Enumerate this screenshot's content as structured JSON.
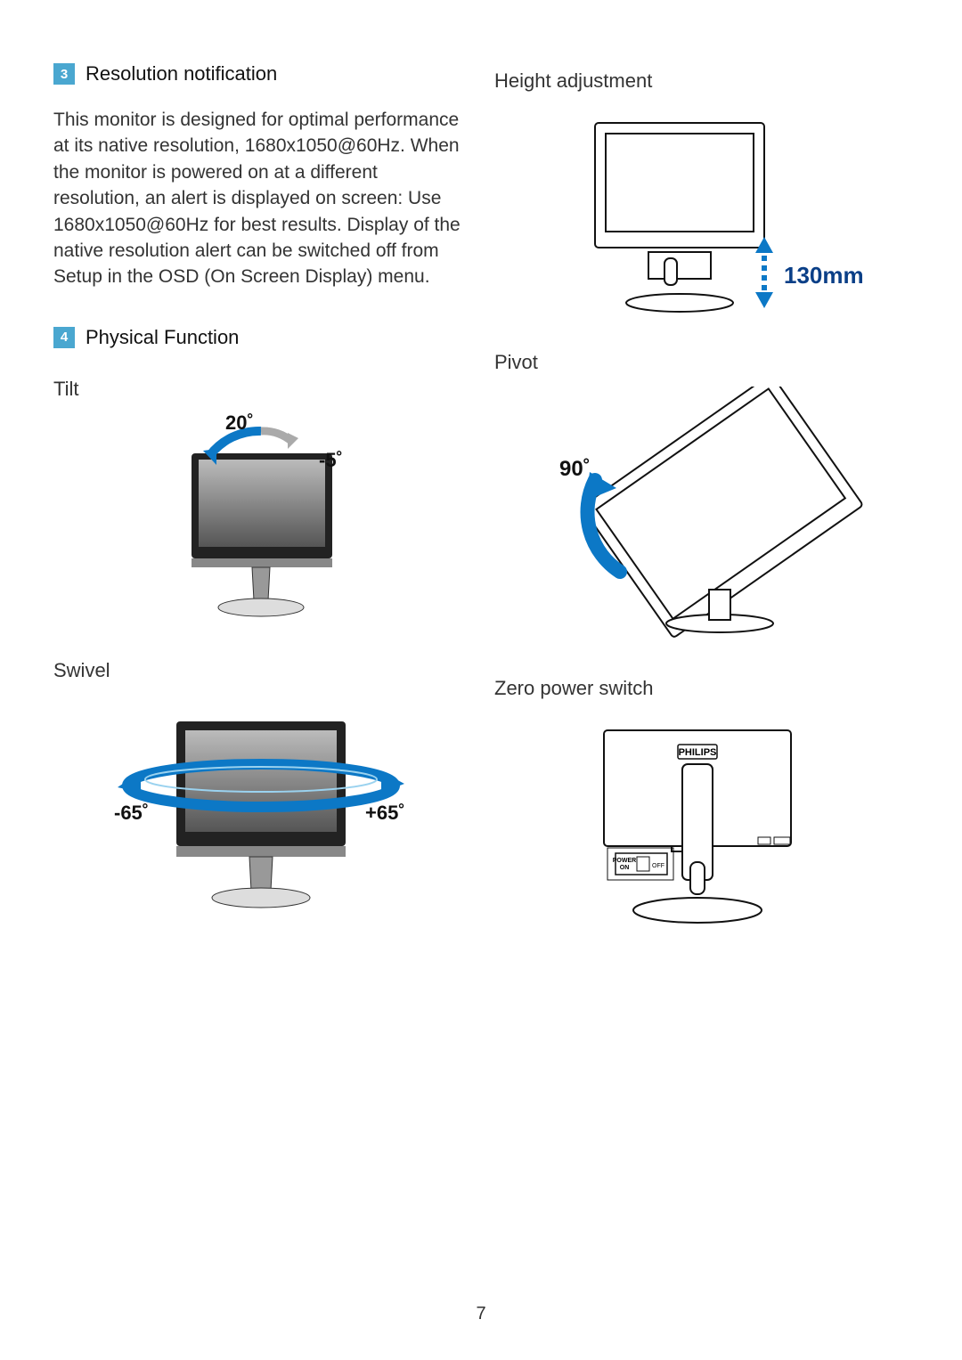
{
  "left": {
    "section3": {
      "num": "3",
      "title": "Resolution notification"
    },
    "body": "This monitor is designed for optimal performance at its native resolution, 1680x1050@60Hz. When the monitor is powered on at a different resolution, an alert is displayed on screen: Use 1680x1050@60Hz for best results. Display of the native resolution alert can be switched off from Setup in the OSD (On Screen Display) menu.",
    "section4": {
      "num": "4",
      "title": "Physical Function"
    },
    "tilt": {
      "label": "Tilt",
      "fwd": "20˚",
      "back": "-5˚"
    },
    "swivel": {
      "label": "Swivel",
      "neg": "-65˚",
      "pos": "+65˚"
    }
  },
  "right": {
    "height": {
      "label": "Height adjustment",
      "value": "130mm"
    },
    "pivot": {
      "label": "Pivot",
      "deg": "90˚"
    },
    "zero": {
      "label": "Zero power switch",
      "brand": "PHILIPS",
      "power": "POWER",
      "on": "ON",
      "off": "OFF"
    }
  },
  "page_number": "7"
}
